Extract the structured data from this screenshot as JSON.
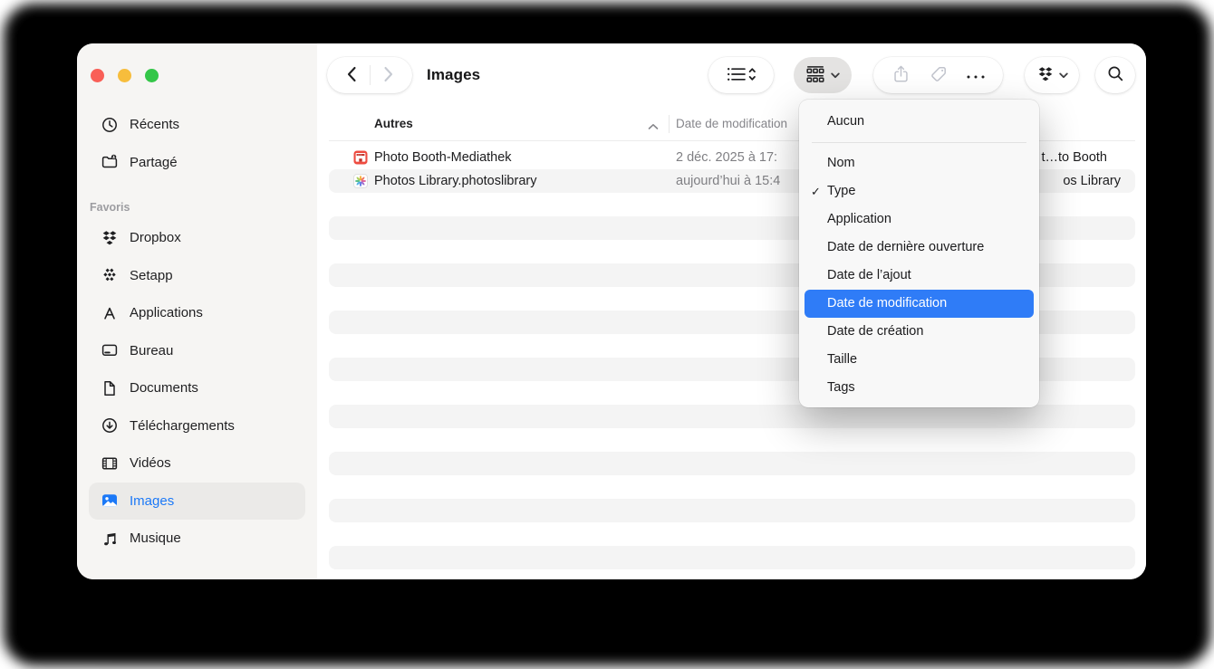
{
  "colors": {
    "accent_blue": "#2f7cf7",
    "sidebar_selected_blue": "#1c79f7",
    "window_bg": "#ffffff",
    "sidebar_bg": "#f6f5f3",
    "row_stripe": "#f4f4f4",
    "backdrop": "#000000",
    "traffic_red": "#f95f57",
    "traffic_yellow": "#f7bd3c",
    "traffic_green": "#34c648"
  },
  "toolbar": {
    "title": "Images",
    "icons": [
      "back-chevron-icon",
      "forward-chevron-icon",
      "list-view-icon",
      "group-grid-icon",
      "chevron-down-icon",
      "share-icon",
      "tag-icon",
      "ellipsis-icon",
      "dropbox-icon",
      "search-icon"
    ],
    "buttons": [
      {
        "name": "view-options",
        "state": "enabled"
      },
      {
        "name": "group-by",
        "state": "active"
      },
      {
        "name": "share",
        "state": "disabled"
      },
      {
        "name": "tag",
        "state": "disabled"
      },
      {
        "name": "more",
        "state": "enabled"
      },
      {
        "name": "dropbox",
        "state": "enabled"
      },
      {
        "name": "search",
        "state": "enabled"
      }
    ]
  },
  "sidebar": {
    "top_items": [
      {
        "label": "Récents",
        "icon": "clock-icon"
      },
      {
        "label": "Partagé",
        "icon": "shared-folder-icon"
      }
    ],
    "section_label": "Favoris",
    "favorites": [
      {
        "label": "Dropbox",
        "icon": "dropbox-icon"
      },
      {
        "label": "Setapp",
        "icon": "setapp-icon"
      },
      {
        "label": "Applications",
        "icon": "appstore-icon"
      },
      {
        "label": "Bureau",
        "icon": "desktop-icon"
      },
      {
        "label": "Documents",
        "icon": "document-icon"
      },
      {
        "label": "Téléchargements",
        "icon": "download-icon"
      },
      {
        "label": "Vidéos",
        "icon": "film-icon"
      },
      {
        "label": "Images",
        "icon": "photo-icon",
        "selected": true
      },
      {
        "label": "Musique",
        "icon": "music-icon"
      }
    ]
  },
  "list": {
    "group_header": "Autres",
    "sort_ascending": true,
    "date_column_label": "Date de modification",
    "files": [
      {
        "name": "Photo Booth-Mediathek",
        "icon": "photo-booth-icon",
        "date_modified": "2 déc. 2025 à 17:",
        "right_fragment": "t…to Booth"
      },
      {
        "name": "Photos Library.photoslibrary",
        "icon": "photos-app-icon",
        "date_modified": "aujourd’hui à 15:4",
        "right_fragment": "os Library",
        "shaded": true
      }
    ],
    "empty_rows": 16
  },
  "group_menu": {
    "items": [
      {
        "label": "Aucun"
      },
      {
        "divider": true
      },
      {
        "label": "Nom"
      },
      {
        "label": "Type",
        "checked": true
      },
      {
        "label": "Application"
      },
      {
        "label": "Date de dernière ouverture"
      },
      {
        "label": "Date de l’ajout"
      },
      {
        "label": "Date de modification",
        "highlighted": true
      },
      {
        "label": "Date de création"
      },
      {
        "label": "Taille"
      },
      {
        "label": "Tags"
      }
    ]
  }
}
